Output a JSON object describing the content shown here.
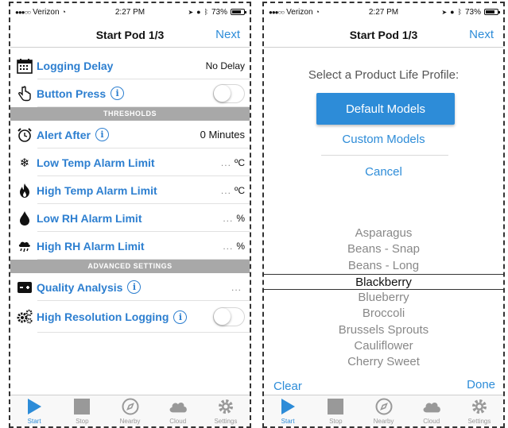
{
  "status": {
    "carrier": "Verizon",
    "time": "2:27 PM",
    "battery": "73%"
  },
  "left": {
    "title": "Start Pod 1/3",
    "next": "Next",
    "rows": {
      "logging_delay": {
        "label": "Logging Delay",
        "value": "No Delay"
      },
      "button_press": {
        "label": "Button Press"
      },
      "alert_after": {
        "label": "Alert After",
        "value": "0 Minutes"
      },
      "low_temp": {
        "label": "Low Temp Alarm Limit",
        "dots": "...",
        "unit": "ºC"
      },
      "high_temp": {
        "label": "High Temp Alarm Limit",
        "dots": "...",
        "unit": "ºC"
      },
      "low_rh": {
        "label": "Low RH Alarm Limit",
        "dots": "...",
        "unit": "%"
      },
      "high_rh": {
        "label": "High RH Alarm Limit",
        "dots": "...",
        "unit": "%"
      },
      "quality": {
        "label": "Quality Analysis",
        "dots": "..."
      },
      "high_res": {
        "label": "High Resolution Logging"
      }
    },
    "sections": {
      "thresholds": "THRESHOLDS",
      "advanced": "ADVANCED SETTINGS"
    },
    "info_glyph": "i"
  },
  "right": {
    "title": "Start Pod 1/3",
    "next": "Next",
    "prompt": "Select a Product Life Profile:",
    "default_models": "Default Models",
    "custom_models": "Custom Models",
    "cancel": "Cancel",
    "picker_items": [
      "Asparagus",
      "Beans - Snap",
      "Beans - Long",
      "Blackberry",
      "Blueberry",
      "Broccoli",
      "Brussels Sprouts",
      "Cauliflower",
      "Cherry Sweet"
    ],
    "selected": "Blackberry",
    "clear": "Clear",
    "done": "Done"
  },
  "tabs": [
    {
      "label": "Start",
      "icon": "play-icon"
    },
    {
      "label": "Stop",
      "icon": "stop-icon"
    },
    {
      "label": "Nearby",
      "icon": "compass-icon"
    },
    {
      "label": "Cloud",
      "icon": "cloud-icon"
    },
    {
      "label": "Settings",
      "icon": "gear-icon"
    }
  ],
  "colors": {
    "accent": "#2d8cd8",
    "label_blue": "#2d7fd0",
    "section_gray": "#a8a8a8"
  }
}
